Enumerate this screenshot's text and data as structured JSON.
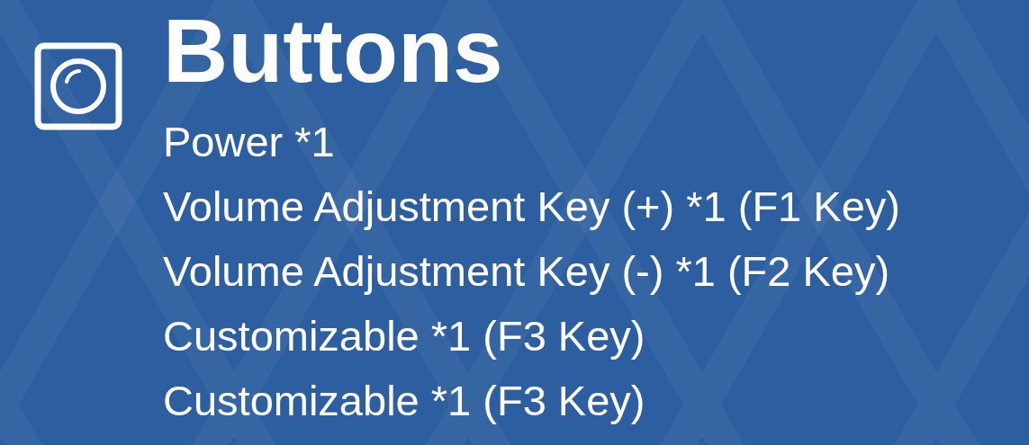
{
  "section": {
    "title": "Buttons",
    "items": [
      "Power *1",
      "Volume Adjustment Key (+) *1 (F1 Key)",
      "Volume Adjustment Key (-) *1 (F2 Key)",
      "Customizable *1 (F3 Key)",
      "Customizable *1 (F3 Key)"
    ]
  }
}
